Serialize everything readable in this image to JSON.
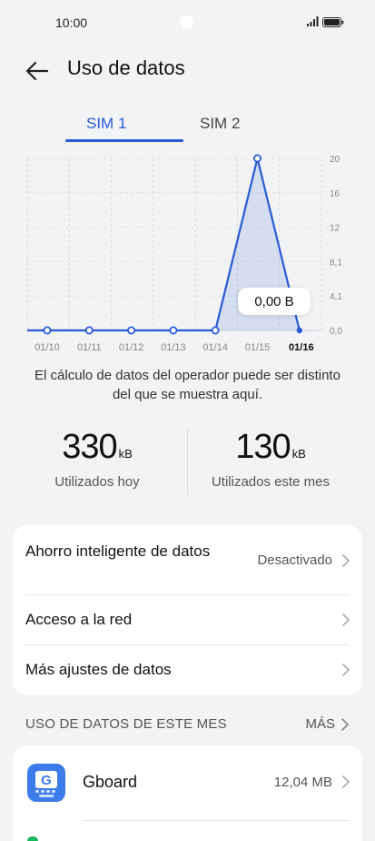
{
  "status_bar": {
    "time": "10:00"
  },
  "header": {
    "title": "Uso de datos"
  },
  "tabs": [
    {
      "label": "SIM 1",
      "active": true
    },
    {
      "label": "SIM 2",
      "active": false
    }
  ],
  "chart_data": {
    "type": "area",
    "x": [
      "01/10",
      "01/11",
      "01/12",
      "01/13",
      "01/14",
      "01/15",
      "01/16"
    ],
    "values": [
      0,
      0,
      0,
      0,
      0,
      20,
      0
    ],
    "yticks": [
      "20",
      "16",
      "12",
      "8,1",
      "4,1",
      "0,0"
    ],
    "ylim": [
      0,
      20
    ],
    "highlighted_x": "01/16",
    "tooltip": "0,00 B",
    "accent_color": "#2a5bd7"
  },
  "note": "El cálculo de datos del operador puede ser distinto del que se muestra aquí.",
  "stats": {
    "today": {
      "value": "330",
      "unit": "kB",
      "label": "Utilizados hoy"
    },
    "month": {
      "value": "130",
      "unit": "kB",
      "label": "Utilizados este mes"
    }
  },
  "settings": {
    "smart_saver": {
      "label": "Ahorro inteligente de datos",
      "value": "Desactivado"
    },
    "network_access": {
      "label": "Acceso a la red"
    },
    "more_settings": {
      "label": "Más ajustes de datos"
    }
  },
  "section": {
    "title": "USO DE DATOS DE ESTE MES",
    "more": "MÁS"
  },
  "apps": [
    {
      "name": "Gboard",
      "usage": "12,04 MB",
      "icon": "gboard-icon"
    }
  ]
}
